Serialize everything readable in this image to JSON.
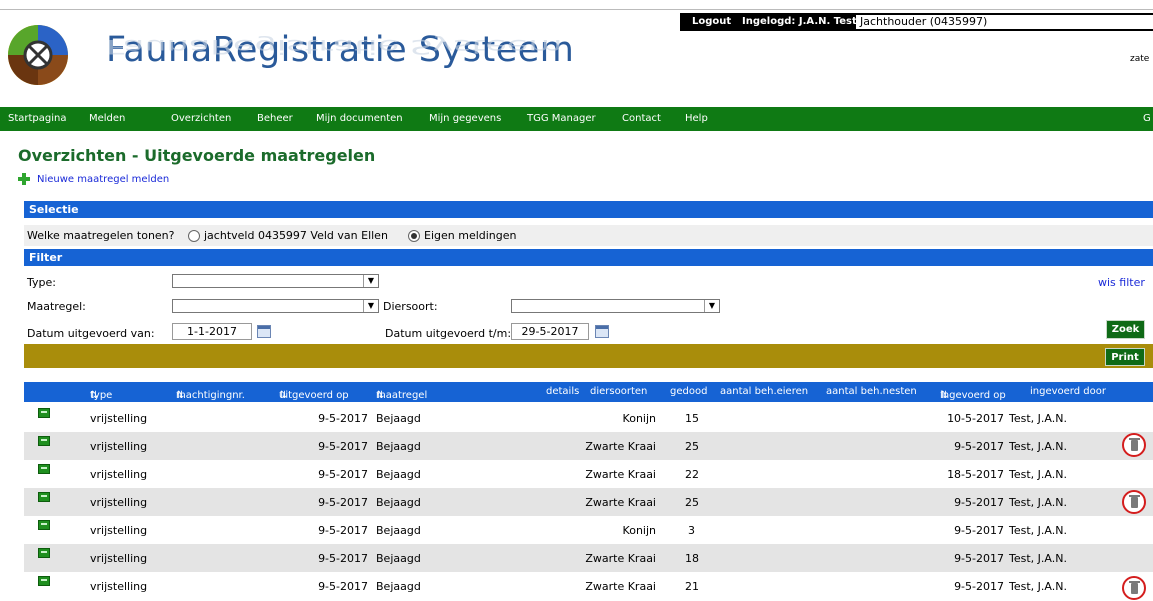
{
  "header": {
    "app_title": "FaunaRegistratie Systeem",
    "logout": "Logout",
    "logged_in": "Ingelogd: J.A.N. Test",
    "role": "Jachthouder (0435997)",
    "date_fragment": "zate"
  },
  "nav": {
    "items": [
      "Startpagina",
      "Melden",
      "Overzichten",
      "Beheer",
      "Mijn documenten",
      "Mijn gegevens",
      "TGG Manager",
      "Contact",
      "Help"
    ],
    "tail": "G"
  },
  "page": {
    "title": "Overzichten - Uitgevoerde maatregelen",
    "new_link": "Nieuwe maatregel melden"
  },
  "selection": {
    "header": "Selectie",
    "question": "Welke maatregelen tonen?",
    "option_1": "jachtveld 0435997 Veld van Ellen",
    "option_2": "Eigen meldingen",
    "selected": "Eigen meldingen"
  },
  "filter": {
    "header": "Filter",
    "type_label": "Type:",
    "type_value": "",
    "maatregel_label": "Maatregel:",
    "maatregel_value": "",
    "diersoort_label": "Diersoort:",
    "diersoort_value": "",
    "date_from_label": "Datum uitgevoerd van:",
    "date_from": "1-1-2017",
    "date_to_label": "Datum uitgevoerd t/m:",
    "date_to": "29-5-2017",
    "clear": "wis filter",
    "search": "Zoek",
    "print": "Print"
  },
  "table": {
    "headers": [
      "type",
      "machtigingnr.",
      "uitgevoerd op",
      "maatregel",
      "details",
      "diersoorten",
      "gedood",
      "aantal beh.eieren",
      "aantal beh.nesten",
      "ingevoerd op",
      "ingevoerd door"
    ],
    "sort_marker": "⇅",
    "rows": [
      {
        "type": "vrijstelling",
        "machtigingnr": "",
        "uitgevoerd_op": "9-5-2017",
        "maatregel": "Bejaagd",
        "details": "",
        "diersoorten": "Konijn",
        "gedood": "15",
        "eieren": "",
        "nesten": "",
        "ingevoerd_op": "10-5-2017",
        "ingevoerd_door": "Test, J.A.N.",
        "deletable": false
      },
      {
        "type": "vrijstelling",
        "machtigingnr": "",
        "uitgevoerd_op": "9-5-2017",
        "maatregel": "Bejaagd",
        "details": "",
        "diersoorten": "Zwarte Kraai",
        "gedood": "25",
        "eieren": "",
        "nesten": "",
        "ingevoerd_op": "9-5-2017",
        "ingevoerd_door": "Test, J.A.N.",
        "deletable": true
      },
      {
        "type": "vrijstelling",
        "machtigingnr": "",
        "uitgevoerd_op": "9-5-2017",
        "maatregel": "Bejaagd",
        "details": "",
        "diersoorten": "Zwarte Kraai",
        "gedood": "22",
        "eieren": "",
        "nesten": "",
        "ingevoerd_op": "18-5-2017",
        "ingevoerd_door": "Test, J.A.N.",
        "deletable": false
      },
      {
        "type": "vrijstelling",
        "machtigingnr": "",
        "uitgevoerd_op": "9-5-2017",
        "maatregel": "Bejaagd",
        "details": "",
        "diersoorten": "Zwarte Kraai",
        "gedood": "25",
        "eieren": "",
        "nesten": "",
        "ingevoerd_op": "9-5-2017",
        "ingevoerd_door": "Test, J.A.N.",
        "deletable": true
      },
      {
        "type": "vrijstelling",
        "machtigingnr": "",
        "uitgevoerd_op": "9-5-2017",
        "maatregel": "Bejaagd",
        "details": "",
        "diersoorten": "Konijn",
        "gedood": "3",
        "eieren": "",
        "nesten": "",
        "ingevoerd_op": "9-5-2017",
        "ingevoerd_door": "Test, J.A.N.",
        "deletable": false
      },
      {
        "type": "vrijstelling",
        "machtigingnr": "",
        "uitgevoerd_op": "9-5-2017",
        "maatregel": "Bejaagd",
        "details": "",
        "diersoorten": "Zwarte Kraai",
        "gedood": "18",
        "eieren": "",
        "nesten": "",
        "ingevoerd_op": "9-5-2017",
        "ingevoerd_door": "Test, J.A.N.",
        "deletable": false
      },
      {
        "type": "vrijstelling",
        "machtigingnr": "",
        "uitgevoerd_op": "9-5-2017",
        "maatregel": "Bejaagd",
        "details": "",
        "diersoorten": "Zwarte Kraai",
        "gedood": "21",
        "eieren": "",
        "nesten": "",
        "ingevoerd_op": "9-5-2017",
        "ingevoerd_door": "Test, J.A.N.",
        "deletable": true
      }
    ]
  },
  "colors": {
    "nav_green": "#0f7a14",
    "bar_blue": "#1663d4",
    "olive": "#a98d0b",
    "title_green": "#1b6b2b",
    "link_blue": "#1a2ad8",
    "trash_red": "#d41d1d"
  }
}
